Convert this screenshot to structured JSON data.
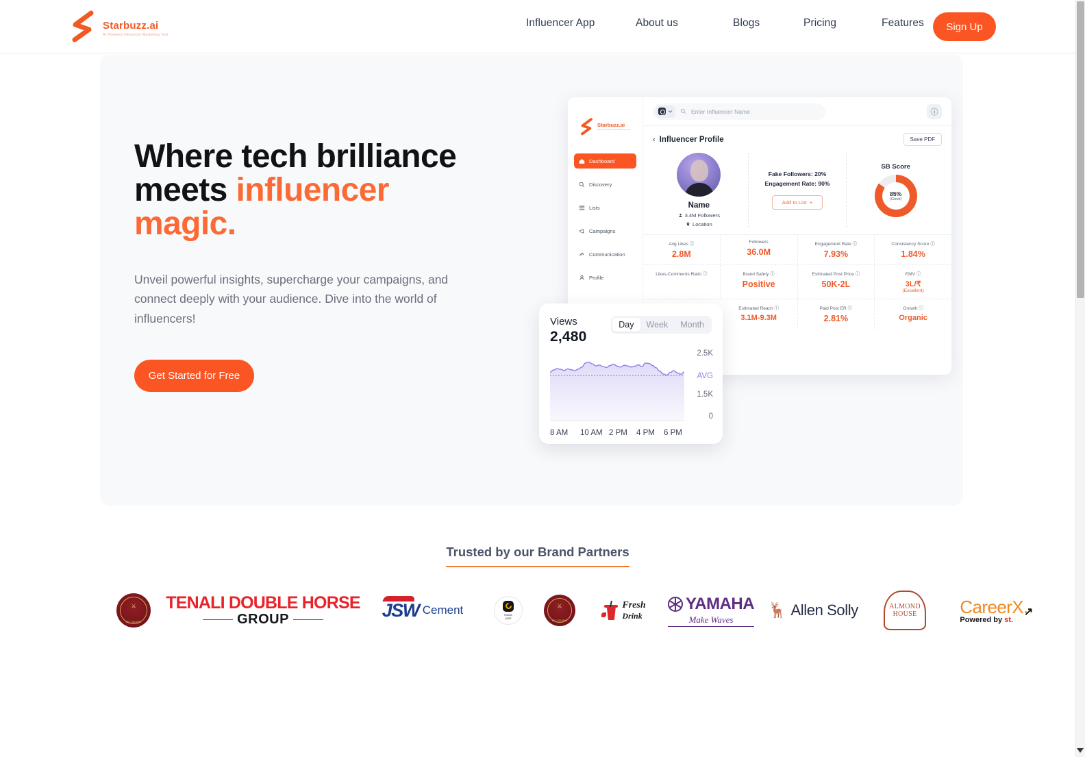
{
  "brand": {
    "name": "Starbuzz.ai",
    "tagline": "AI Powered Influencer Marketing Tool",
    "logo_icon": "starbuzz-s-logo"
  },
  "nav": {
    "links": [
      {
        "label": "Influencer App"
      },
      {
        "label": "About us"
      },
      {
        "label": "Blogs"
      },
      {
        "label": "Pricing"
      },
      {
        "label": "Features"
      }
    ],
    "signup_label": "Sign Up"
  },
  "hero": {
    "heading_line1": "Where tech brilliance",
    "heading_line2_plain": "meets ",
    "heading_line2_accent": "influencer",
    "heading_line3_accent": "magic.",
    "paragraph": "Unveil powerful insights, supercharge your campaigns, and connect deeply with your audience. Dive into the world of influencers!",
    "cta_label": "Get Started for Free",
    "accent_color": "#fb6a35",
    "cta_color": "#fb5523",
    "panel_bg": "#f8f9fb"
  },
  "app_mock": {
    "sidebar": {
      "items": [
        {
          "label": "Dashboard",
          "icon": "home-icon",
          "active": true
        },
        {
          "label": "Discovery",
          "icon": "search-icon",
          "active": false
        },
        {
          "label": "Lists",
          "icon": "list-icon",
          "active": false
        },
        {
          "label": "Campaigns",
          "icon": "megaphone-icon",
          "active": false
        },
        {
          "label": "Communication",
          "icon": "chat-icon",
          "active": false
        },
        {
          "label": "Profile",
          "icon": "user-icon",
          "active": false
        }
      ]
    },
    "topbar": {
      "platform_icon": "instagram-icon",
      "chevron_icon": "chevron-down-icon",
      "search_placeholder": "Enter Influencer Name",
      "search_icon": "search-icon",
      "help_icon": "help-circle-icon"
    },
    "page": {
      "back_icon": "chevron-left-icon",
      "title": "Influencer Profile",
      "save_pdf_label": "Save PDF"
    },
    "profile": {
      "avatar_icon": "avatar-photo",
      "name": "Name",
      "followers": "3.4M Followers",
      "followers_icon": "user-icon",
      "location": "Location",
      "location_icon": "pin-icon"
    },
    "summary": {
      "fake_followers": "Fake Followers: 20%",
      "engagement_rate": "Engagement Rate: 90%",
      "add_to_list_label": "Add to List",
      "add_icon": "plus-icon"
    },
    "sb_score": {
      "title": "SB Score",
      "value": "85%",
      "qualifier": "(Good)",
      "percent": 85,
      "ring_color": "#ef5a2b",
      "track_color": "#ededf1"
    },
    "metrics": [
      [
        {
          "label": "Avg Likes",
          "info": true,
          "value": "2.8M"
        },
        {
          "label": "Followers",
          "info": false,
          "value": "36.0M"
        },
        {
          "label": "Engagement Rate",
          "info": true,
          "value": "7.93%"
        },
        {
          "label": "Consistency Score",
          "info": true,
          "value": "1.84%"
        }
      ],
      [
        {
          "label": "Likes-Comments Ratio",
          "info": true,
          "value": ""
        },
        {
          "label": "Brand Safety",
          "info": true,
          "value": "Positive"
        },
        {
          "label": "Estimated Post Price",
          "info": true,
          "value": "50K-2L"
        },
        {
          "label": "EMV",
          "info": true,
          "value": "3L/₹",
          "sub": "(Excellent)"
        }
      ],
      [
        {
          "label": "",
          "info": false,
          "value": ""
        },
        {
          "label": "Estimated Reach",
          "info": true,
          "value": "3.1M-9.3M"
        },
        {
          "label": "Paid Post ER",
          "info": true,
          "value": "2.81%"
        },
        {
          "label": "Growth",
          "info": true,
          "value": "Organic"
        }
      ]
    ]
  },
  "views_card": {
    "label": "Views",
    "value": "2,480",
    "range_tabs": [
      {
        "label": "Day",
        "active": true
      },
      {
        "label": "Week",
        "active": false
      },
      {
        "label": "Month",
        "active": false
      }
    ]
  },
  "chart_data": {
    "type": "area",
    "title": "Views",
    "xlabel": "",
    "ylabel": "",
    "ylim": [
      0,
      2800
    ],
    "yticks": [
      "2.5K",
      "AVG",
      "1.5K",
      "0"
    ],
    "ytick_values": [
      2500,
      2000,
      1500,
      0
    ],
    "avg_line": 2000,
    "avg_label": "AVG",
    "grid": false,
    "legend": "none",
    "line_color": "#8b7ee8",
    "fill_color": "#ded9f7",
    "categories": [
      "8 AM",
      "10 AM",
      "2 PM",
      "4 PM",
      "6 PM"
    ],
    "x": [
      0,
      1,
      2,
      3,
      4,
      5,
      6,
      7,
      8,
      9,
      10,
      11,
      12,
      13,
      14,
      15,
      16,
      17,
      18,
      19,
      20,
      21,
      22,
      23,
      24,
      25,
      26,
      27,
      28,
      29,
      30,
      31,
      32,
      33,
      34,
      35,
      36,
      37,
      38
    ],
    "values": [
      2150,
      2250,
      2310,
      2280,
      2230,
      2300,
      2260,
      2220,
      2290,
      2380,
      2560,
      2600,
      2520,
      2430,
      2470,
      2400,
      2360,
      2450,
      2510,
      2420,
      2380,
      2460,
      2430,
      2380,
      2420,
      2480,
      2400,
      2560,
      2540,
      2450,
      2350,
      2200,
      2080,
      2020,
      2140,
      2220,
      2120,
      2060,
      2160
    ],
    "total_views": 2480
  },
  "partners": {
    "title": "Trusted by our Brand Partners",
    "underline_color": "#ef7d2f",
    "logos": [
      {
        "name": "seal-emblem-logo",
        "text": ""
      },
      {
        "name": "tenali-double-horse-group-logo",
        "line1": "TENALI DOUBLE HORSE",
        "line2": "GROUP"
      },
      {
        "name": "jsw-cement-logo",
        "mark": "JSW",
        "text": "Cement"
      },
      {
        "name": "mana-yatri-logo",
        "line1": "mana",
        "line2": "yatri"
      },
      {
        "name": "seal-emblem-logo-2",
        "text": ""
      },
      {
        "name": "fresh-drink-logo",
        "line1": "Fresh",
        "line2": "Drink"
      },
      {
        "name": "yamaha-logo",
        "name_text": "YAMAHA",
        "tagline": "Make Waves"
      },
      {
        "name": "allen-solly-logo",
        "text": "Allen Solly"
      },
      {
        "name": "almond-house-logo",
        "line1": "ALMOND",
        "line2": "HOUSE"
      },
      {
        "name": "careerx-logo",
        "text": "CareerX.",
        "sub_plain": "Powered by ",
        "sub_accent": "st."
      }
    ]
  }
}
